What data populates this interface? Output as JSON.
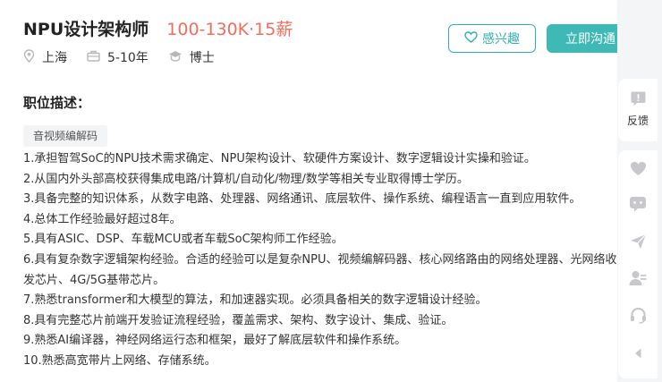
{
  "job": {
    "title": "NPU设计架构师",
    "salary": "100-130K·15薪",
    "location": "上海",
    "experience": "5-10年",
    "degree": "博士"
  },
  "actions": {
    "interest_label": "感兴趣",
    "chat_label": "立即沟通"
  },
  "description": {
    "heading": "职位描述：",
    "tag": "音视频编解码",
    "lines": [
      "1.承担智驾SoC的NPU技术需求确定、NPU架构设计、软硬件方案设计、数字逻辑设计实操和验证。",
      "2.从国内外头部高校获得集成电路/计算机/自动化/物理/数学等相关专业取得博士学历。",
      "3.具备完整的知识体系，从数字电路、处理器、网络通讯、底层软件、操作系统、编程语言一直到应用软件。",
      "4.总体工作经验最好超过8年。",
      "5.具有ASIC、DSP、车载MCU或者车载SoC架构师工作经验。",
      "6.具有复杂数字逻辑架构经验。合适的经验可以是复杂NPU、视频编解码器、核心网络路由的网络处理器、光网络收",
      "发芯片、4G/5G基带芯片。",
      "7.熟悉transformer和大模型的算法，和加速器实现。必须具备相关的数字逻辑设计经验。",
      "8.具有完整芯片前端开发验证流程经验，覆盖需求、架构、数字设计、集成、验证。",
      "9.熟悉AI编译器，神经网络运行态和框架，最好了解底层软件和操作系统。",
      "10.熟悉高宽带片上网络、存储系统。"
    ]
  },
  "sidebar": {
    "feedback_label": "反馈"
  },
  "colors": {
    "salary": "#f26d5b",
    "accent": "#3fb9b6",
    "sidebar_icon": "#c8c8cc"
  }
}
